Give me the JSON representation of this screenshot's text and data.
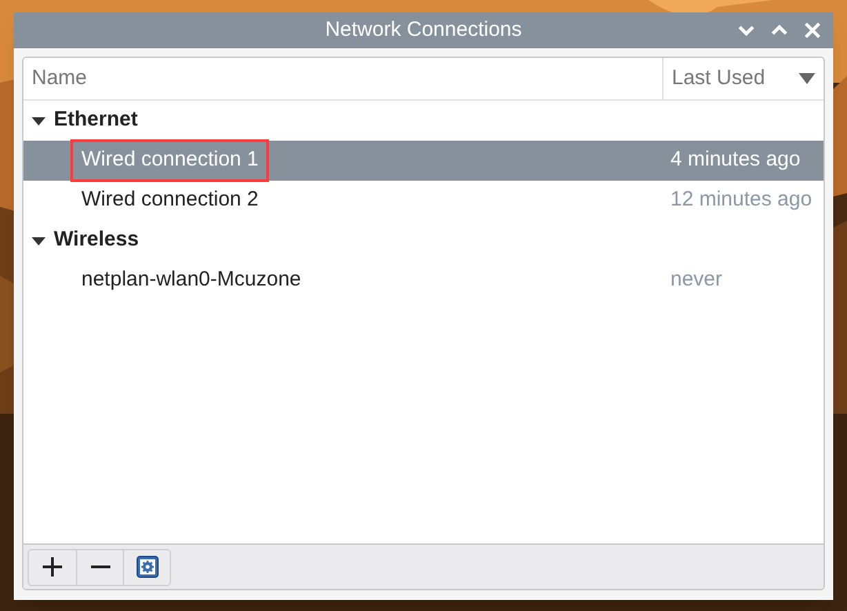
{
  "window": {
    "title": "Network Connections",
    "controls": [
      {
        "kind": "minimize"
      },
      {
        "kind": "maximize"
      },
      {
        "kind": "close"
      }
    ]
  },
  "table": {
    "columns": [
      "Name",
      "Last Used"
    ],
    "groups": [
      {
        "name": "Ethernet",
        "expanded": true,
        "rows": [
          {
            "name": "Wired connection 1",
            "last_used": "4 minutes ago",
            "selected": true,
            "annotated": true
          },
          {
            "name": "Wired connection 2",
            "last_used": "12 minutes ago",
            "selected": false,
            "annotated": false
          }
        ]
      },
      {
        "name": "Wireless",
        "expanded": true,
        "rows": [
          {
            "name": "netplan-wlan0-Mcuzone",
            "last_used": "never",
            "selected": false,
            "annotated": false
          }
        ]
      }
    ]
  },
  "toolbar": [
    {
      "kind": "add"
    },
    {
      "kind": "remove"
    },
    {
      "kind": "settings"
    }
  ]
}
